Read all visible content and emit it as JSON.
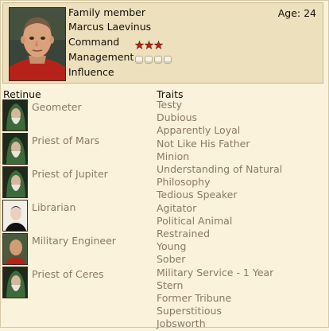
{
  "character": {
    "type_label": "Family member",
    "age": "Age: 24",
    "name": "Marcus Laevinus",
    "command_label": "Command",
    "management_label": "Management",
    "influence_label": "Influence",
    "command_stars": 3,
    "management_pips": 4
  },
  "retinue": {
    "heading": "Retinue",
    "items": [
      {
        "label": "Geometer",
        "icon": "hooded-elder-icon"
      },
      {
        "label": "Priest of Mars",
        "icon": "hooded-elder-icon"
      },
      {
        "label": "Priest of Jupiter",
        "icon": "hooded-elder-icon"
      },
      {
        "label": "Librarian",
        "icon": "pale-scholar-icon"
      },
      {
        "label": "Military Engineer",
        "icon": "soldier-portrait-icon"
      },
      {
        "label": "Priest of Ceres",
        "icon": "hooded-elder-icon"
      }
    ]
  },
  "traits": {
    "heading": "Traits",
    "items": [
      "Testy",
      "Dubious",
      "Apparently Loyal",
      "Not Like His Father",
      "Minion",
      "Understanding of Natural Philosophy",
      "Tedious Speaker",
      "Agitator",
      "Political Animal",
      "Restrained",
      "Young",
      "Sober",
      "Military Service - 1 Year",
      "Stern",
      "Former Tribune",
      "Superstitious",
      "Jobsworth"
    ]
  },
  "colors": {
    "background": "#fbf2dc",
    "panel": "#ede0bd",
    "muted_text": "#8a7a66",
    "star": "#b02818"
  }
}
